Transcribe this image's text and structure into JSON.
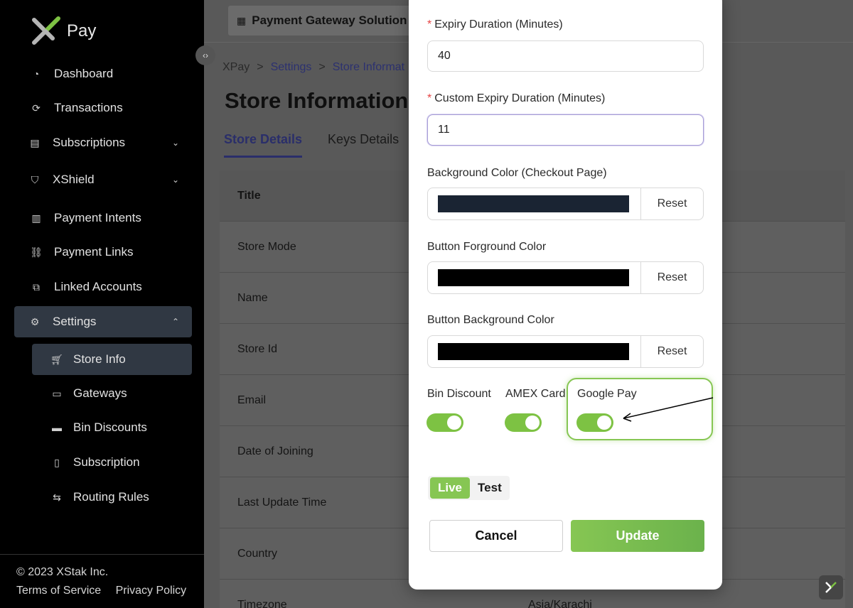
{
  "brand": {
    "name": "Pay"
  },
  "sidebar": {
    "items": [
      {
        "label": "Dashboard",
        "icon": "dashboard-icon"
      },
      {
        "label": "Transactions",
        "icon": "transactions-icon"
      },
      {
        "label": "Subscriptions",
        "icon": "calendar-icon"
      },
      {
        "label": "XShield",
        "icon": "shield-icon"
      },
      {
        "label": "Payment Intents",
        "icon": "document-icon"
      },
      {
        "label": "Payment Links",
        "icon": "link-icon"
      },
      {
        "label": "Linked Accounts",
        "icon": "linked-accounts-icon"
      },
      {
        "label": "Settings",
        "icon": "gear-icon"
      }
    ],
    "settings_sub": [
      {
        "label": "Store Info",
        "icon": "cart-icon"
      },
      {
        "label": "Gateways",
        "icon": "gateway-icon"
      },
      {
        "label": "Bin Discounts",
        "icon": "card-icon"
      },
      {
        "label": "Subscription",
        "icon": "subscription-icon"
      },
      {
        "label": "Routing Rules",
        "icon": "routing-icon"
      }
    ],
    "footer": {
      "copyright": "© 2023 XStak Inc.",
      "terms": "Terms of Service",
      "privacy": "Privacy Policy"
    }
  },
  "header": {
    "store_selector": "Payment Gateway Solution"
  },
  "breadcrumb": {
    "root": "XPay",
    "sep": ">",
    "settings": "Settings",
    "current": "Store Informat"
  },
  "page": {
    "title": "Store Information"
  },
  "tabs": [
    {
      "label": "Store Details"
    },
    {
      "label": "Keys Details"
    }
  ],
  "table": {
    "header": "Title",
    "rows": [
      {
        "title": "Store Mode",
        "value": ""
      },
      {
        "title": "Name",
        "value": ""
      },
      {
        "title": "Store Id",
        "value": ""
      },
      {
        "title": "Email",
        "value": ""
      },
      {
        "title": "Date of Joining",
        "value": ""
      },
      {
        "title": "Last Update Time",
        "value": ""
      },
      {
        "title": "Country",
        "value": ""
      },
      {
        "title": "Timezone",
        "value": "Asia/Karachi"
      }
    ]
  },
  "modal": {
    "expiry": {
      "label": "Expiry Duration (Minutes)",
      "required_mark": "*",
      "value": "40"
    },
    "custom_expiry": {
      "label": "Custom Expiry Duration (Minutes)",
      "required_mark": "*",
      "value": "11"
    },
    "bg_color": {
      "label": "Background Color (Checkout Page)",
      "color": "#1a2433",
      "reset": "Reset"
    },
    "btn_fg_color": {
      "label": "Button Forground Color",
      "color": "#000000",
      "reset": "Reset"
    },
    "btn_bg_color": {
      "label": "Button Background Color",
      "color": "#000000",
      "reset": "Reset"
    },
    "toggles": [
      {
        "label": "Bin Discount",
        "on": true
      },
      {
        "label": "AMEX Card",
        "on": true
      },
      {
        "label": "Google Pay",
        "on": true
      }
    ],
    "mode": {
      "live": "Live",
      "test": "Test",
      "selected": "Live"
    },
    "cancel": "Cancel",
    "update": "Update"
  },
  "colors": {
    "accent_green": "#86c653",
    "brand_dark": "#2a2e6a"
  }
}
